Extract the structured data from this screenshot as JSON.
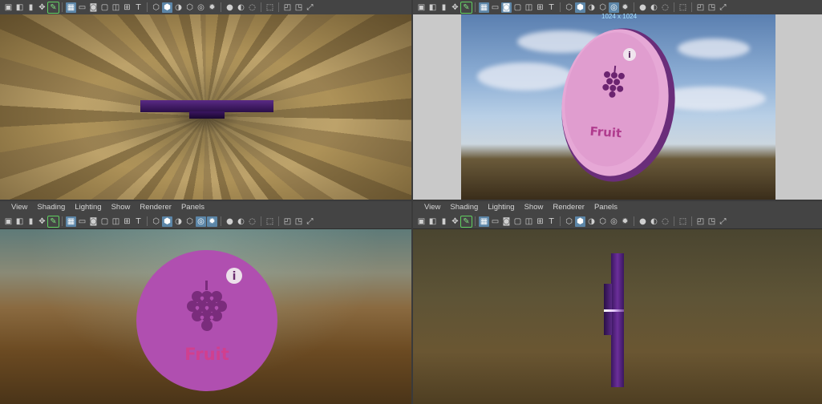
{
  "panel_menu": {
    "items": [
      "View",
      "Shading",
      "Lighting",
      "Show",
      "Renderer",
      "Panels"
    ]
  },
  "top_right": {
    "resolution_label": "1024 x 1024"
  },
  "model": {
    "label": "Fruit",
    "info_glyph": "i",
    "disk_color": "#b04fb0",
    "text_color": "#d0408f",
    "grape_color": "#7a2c7c"
  },
  "colors": {
    "ui_bg": "#444444",
    "accent": "#5c86a8",
    "highlight_green": "#5fd05f"
  }
}
